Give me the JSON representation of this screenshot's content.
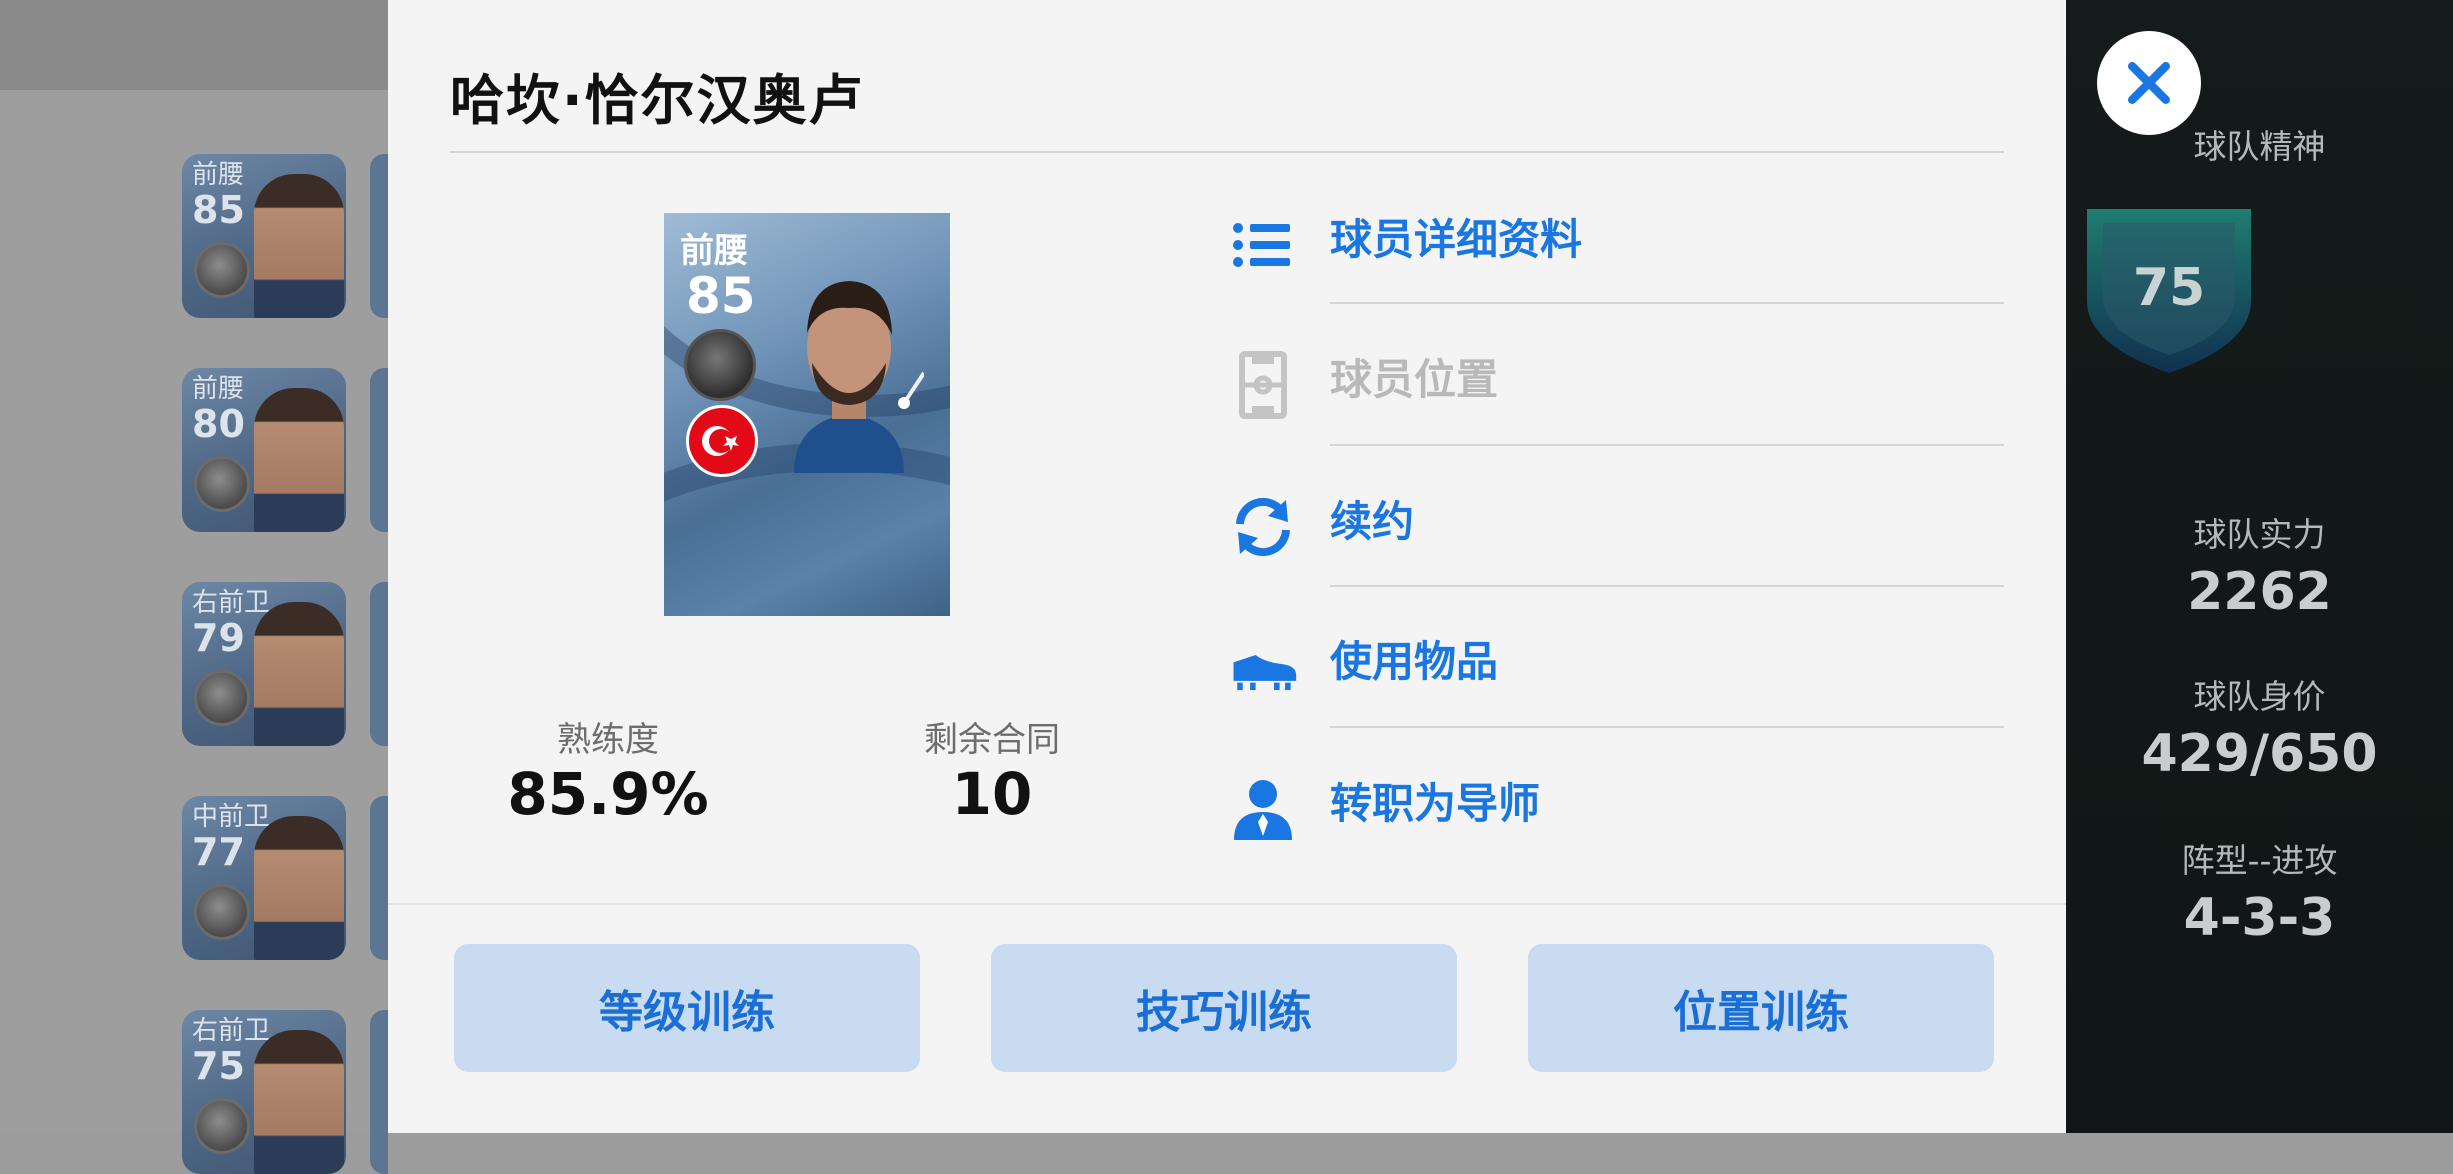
{
  "player": {
    "name": "哈坎·恰尔汉奥卢",
    "position": "前腰",
    "rating": "85"
  },
  "stats": {
    "proficiency_label": "熟练度",
    "proficiency_value": "85.9%",
    "contract_label": "剩余合同",
    "contract_value": "10"
  },
  "menu": {
    "items": [
      {
        "label": "球员详细资料",
        "icon": "list-icon",
        "enabled": true
      },
      {
        "label": "球员位置",
        "icon": "pitch-icon",
        "enabled": false
      },
      {
        "label": "续约",
        "icon": "refresh-icon",
        "enabled": true
      },
      {
        "label": "使用物品",
        "icon": "boot-icon",
        "enabled": true
      },
      {
        "label": "转职为导师",
        "icon": "mentor-icon",
        "enabled": true
      }
    ]
  },
  "buttons": {
    "level_training": "等级训练",
    "skill_training": "技巧训练",
    "position_training": "位置训练"
  },
  "team_panel": {
    "spirit_label": "球队精神",
    "spirit_value": "75",
    "strength_label": "球队实力",
    "strength_value": "2262",
    "value_label": "球队身价",
    "value_value": "429/650",
    "formation_label": "阵型--进攻",
    "formation_value": "4-3-3"
  },
  "roster": [
    {
      "position": "前腰",
      "rating": "85"
    },
    {
      "position": "前腰",
      "rating": "80"
    },
    {
      "position": "右前卫",
      "rating": "79"
    },
    {
      "position": "中前卫",
      "rating": "77"
    },
    {
      "position": "右前卫",
      "rating": "75"
    }
  ],
  "colors": {
    "accent": "#1a76e0",
    "button_bg": "#c8dbf1",
    "modal_bg": "#f4f4f4",
    "panel_bg": "#121918",
    "shield": "#1c6e63"
  }
}
